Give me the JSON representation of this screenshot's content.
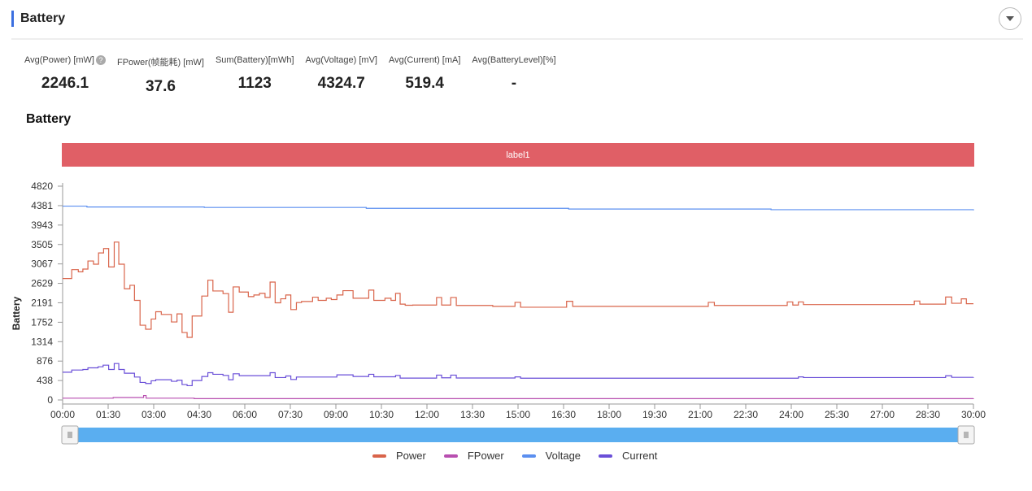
{
  "section": {
    "title": "Battery",
    "collapse_icon": "chevron-down-icon"
  },
  "stats": [
    {
      "label": "Avg(Power) [mW]",
      "value": "2246.1",
      "help": "?"
    },
    {
      "label": "FPower(帧能耗) [mW]",
      "value": "37.6"
    },
    {
      "label": "Sum(Battery)[mWh]",
      "value": "1123"
    },
    {
      "label": "Avg(Voltage) [mV]",
      "value": "4324.7"
    },
    {
      "label": "Avg(Current) [mA]",
      "value": "519.4"
    },
    {
      "label": "Avg(BatteryLevel)[%]",
      "value": "-"
    }
  ],
  "chart_title": "Battery",
  "label_band": "label1",
  "colors": {
    "label_band": "#e05f66",
    "slider": "#5aaef0",
    "accent": "#3b6fe0"
  },
  "chart_data": {
    "type": "line",
    "step": true,
    "ylabel": "Battery",
    "ylim": [
      0,
      4820
    ],
    "yticks": [
      "0",
      "438",
      "876",
      "1314",
      "1752",
      "2191",
      "2629",
      "3067",
      "3505",
      "3943",
      "4381",
      "4820"
    ],
    "xlim": [
      "00:00",
      "30:00"
    ],
    "xticks": [
      "00:00",
      "01:30",
      "03:00",
      "04:30",
      "06:00",
      "07:30",
      "09:00",
      "10:30",
      "12:00",
      "13:30",
      "15:00",
      "16:30",
      "18:00",
      "19:30",
      "21:00",
      "22:30",
      "24:00",
      "25:30",
      "27:00",
      "28:30",
      "30:00"
    ],
    "grid": false,
    "legend_position": "bottom",
    "series": [
      {
        "name": "Power",
        "color": "#d9644a",
        "points": [
          [
            "00:00",
            2737
          ],
          [
            "00:18",
            2938
          ],
          [
            "00:31",
            2889
          ],
          [
            "00:40",
            2950
          ],
          [
            "00:50",
            3133
          ],
          [
            "01:01",
            3060
          ],
          [
            "01:11",
            3315
          ],
          [
            "01:21",
            3413
          ],
          [
            "01:31",
            2999
          ],
          [
            "01:42",
            3559
          ],
          [
            "01:51",
            3060
          ],
          [
            "02:02",
            2506
          ],
          [
            "02:13",
            2585
          ],
          [
            "02:22",
            2245
          ],
          [
            "02:33",
            1685
          ],
          [
            "02:44",
            1594
          ],
          [
            "02:55",
            1825
          ],
          [
            "03:04",
            1989
          ],
          [
            "03:15",
            1928
          ],
          [
            "03:35",
            1758
          ],
          [
            "03:46",
            1940
          ],
          [
            "03:56",
            1520
          ],
          [
            "04:06",
            1411
          ],
          [
            "04:16",
            1892
          ],
          [
            "04:35",
            2342
          ],
          [
            "04:47",
            2700
          ],
          [
            "04:57",
            2457
          ],
          [
            "05:17",
            2397
          ],
          [
            "05:28",
            1977
          ],
          [
            "05:37",
            2549
          ],
          [
            "05:49",
            2433
          ],
          [
            "06:07",
            2330
          ],
          [
            "06:18",
            2366
          ],
          [
            "06:29",
            2403
          ],
          [
            "06:40",
            2311
          ],
          [
            "06:50",
            2658
          ],
          [
            "07:00",
            2190
          ],
          [
            "07:11",
            2281
          ],
          [
            "07:21",
            2366
          ],
          [
            "07:31",
            2038
          ],
          [
            "07:42",
            2196
          ],
          [
            "07:52",
            2220
          ],
          [
            "08:14",
            2317
          ],
          [
            "08:25",
            2245
          ],
          [
            "08:41",
            2293
          ],
          [
            "08:51",
            2263
          ],
          [
            "09:02",
            2366
          ],
          [
            "09:14",
            2464
          ],
          [
            "09:34",
            2293
          ],
          [
            "10:05",
            2476
          ],
          [
            "10:15",
            2245
          ],
          [
            "10:37",
            2293
          ],
          [
            "10:49",
            2245
          ],
          [
            "10:58",
            2403
          ],
          [
            "11:07",
            2160
          ],
          [
            "11:17",
            2135
          ],
          [
            "11:32",
            2140
          ],
          [
            "12:19",
            2310
          ],
          [
            "12:29",
            2140
          ],
          [
            "12:47",
            2310
          ],
          [
            "12:58",
            2130
          ],
          [
            "14:10",
            2110
          ],
          [
            "14:54",
            2200
          ],
          [
            "15:05",
            2090
          ],
          [
            "16:36",
            2225
          ],
          [
            "16:48",
            2110
          ],
          [
            "21:16",
            2200
          ],
          [
            "21:28",
            2130
          ],
          [
            "23:52",
            2210
          ],
          [
            "24:03",
            2140
          ],
          [
            "24:14",
            2210
          ],
          [
            "24:24",
            2150
          ],
          [
            "28:03",
            2230
          ],
          [
            "28:14",
            2160
          ],
          [
            "29:05",
            2320
          ],
          [
            "29:17",
            2180
          ],
          [
            "29:36",
            2280
          ],
          [
            "29:46",
            2170
          ],
          [
            "30:00",
            2170
          ]
        ]
      },
      {
        "name": "FPower",
        "color": "#b84fb0",
        "points": [
          [
            "00:00",
            40
          ],
          [
            "01:40",
            55
          ],
          [
            "02:40",
            100
          ],
          [
            "02:45",
            40
          ],
          [
            "04:20",
            30
          ],
          [
            "30:00",
            35
          ]
        ]
      },
      {
        "name": "Voltage",
        "color": "#5b8ff0",
        "points": [
          [
            "00:00",
            4370
          ],
          [
            "00:48",
            4350
          ],
          [
            "04:40",
            4340
          ],
          [
            "10:00",
            4320
          ],
          [
            "16:40",
            4305
          ],
          [
            "23:20",
            4290
          ],
          [
            "30:00",
            4275
          ]
        ]
      },
      {
        "name": "Current",
        "color": "#6a4fd8",
        "points": [
          [
            "00:00",
            626
          ],
          [
            "00:18",
            675
          ],
          [
            "00:40",
            687
          ],
          [
            "00:50",
            724
          ],
          [
            "01:10",
            748
          ],
          [
            "01:20",
            785
          ],
          [
            "01:31",
            687
          ],
          [
            "01:42",
            821
          ],
          [
            "01:51",
            687
          ],
          [
            "02:02",
            602
          ],
          [
            "02:22",
            517
          ],
          [
            "02:33",
            395
          ],
          [
            "02:44",
            371
          ],
          [
            "02:55",
            432
          ],
          [
            "03:04",
            456
          ],
          [
            "03:35",
            420
          ],
          [
            "03:46",
            444
          ],
          [
            "03:56",
            347
          ],
          [
            "04:06",
            322
          ],
          [
            "04:16",
            438
          ],
          [
            "04:35",
            529
          ],
          [
            "04:47",
            614
          ],
          [
            "04:57",
            578
          ],
          [
            "05:17",
            553
          ],
          [
            "05:28",
            456
          ],
          [
            "05:37",
            590
          ],
          [
            "05:49",
            547
          ],
          [
            "06:50",
            614
          ],
          [
            "07:00",
            505
          ],
          [
            "07:21",
            541
          ],
          [
            "07:31",
            462
          ],
          [
            "07:42",
            517
          ],
          [
            "09:02",
            566
          ],
          [
            "09:34",
            529
          ],
          [
            "10:05",
            578
          ],
          [
            "10:15",
            523
          ],
          [
            "10:58",
            553
          ],
          [
            "11:07",
            493
          ],
          [
            "12:19",
            560
          ],
          [
            "12:29",
            500
          ],
          [
            "12:47",
            560
          ],
          [
            "12:58",
            495
          ],
          [
            "14:54",
            520
          ],
          [
            "15:05",
            490
          ],
          [
            "24:14",
            520
          ],
          [
            "24:24",
            505
          ],
          [
            "29:05",
            545
          ],
          [
            "29:17",
            510
          ],
          [
            "30:00",
            513
          ]
        ]
      }
    ]
  },
  "slider": {
    "start": 0,
    "end": 1,
    "handle_icon": "grip-icon"
  }
}
